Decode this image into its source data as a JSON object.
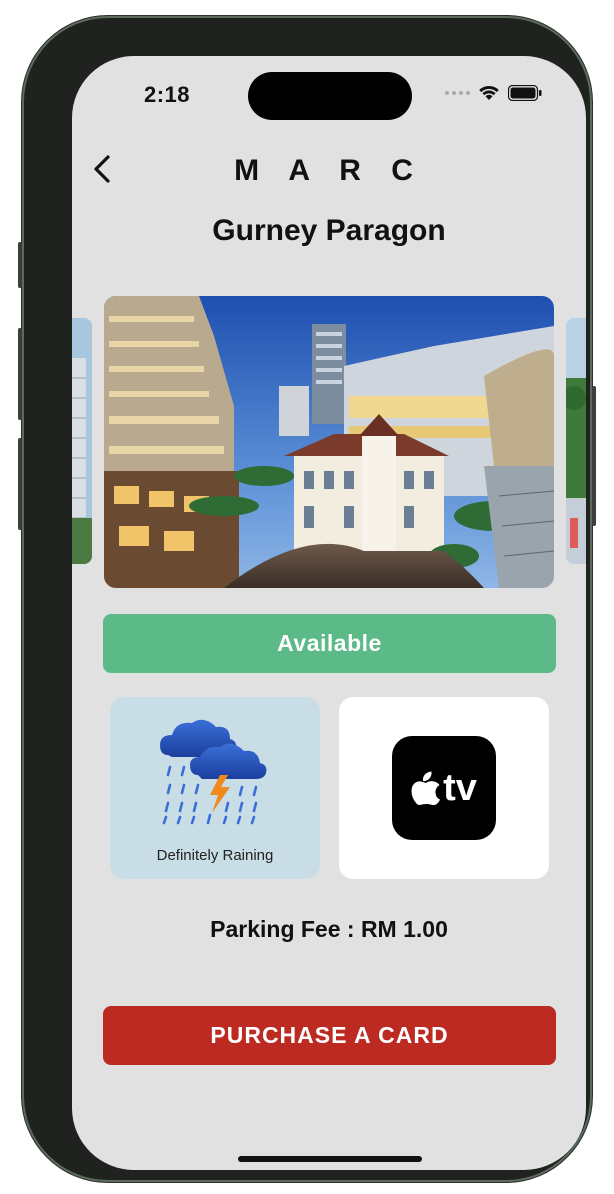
{
  "status_bar": {
    "time": "2:18",
    "icons": [
      "cellular-dots-icon",
      "wifi-icon",
      "battery-icon"
    ]
  },
  "header": {
    "brand": "M A R C",
    "location_title": "Gurney Paragon",
    "back_icon": "chevron-left-icon"
  },
  "carousel": {
    "main_image": "Gurney Paragon mall at dusk",
    "prev_image": "adjacent building photo",
    "next_image": "adjacent building photo"
  },
  "availability": {
    "label": "Available",
    "color": "#5bba87"
  },
  "weather": {
    "icon": "thunderstorm-rain-icon",
    "label": "Definitely Raining",
    "background": "#c9dde6"
  },
  "entertainment": {
    "icon": "apple-tv-icon",
    "label": "tv"
  },
  "parking": {
    "fee_text": "Parking Fee : RM 1.00"
  },
  "actions": {
    "purchase_label": "PURCHASE A CARD",
    "purchase_color": "#bd2a21"
  }
}
